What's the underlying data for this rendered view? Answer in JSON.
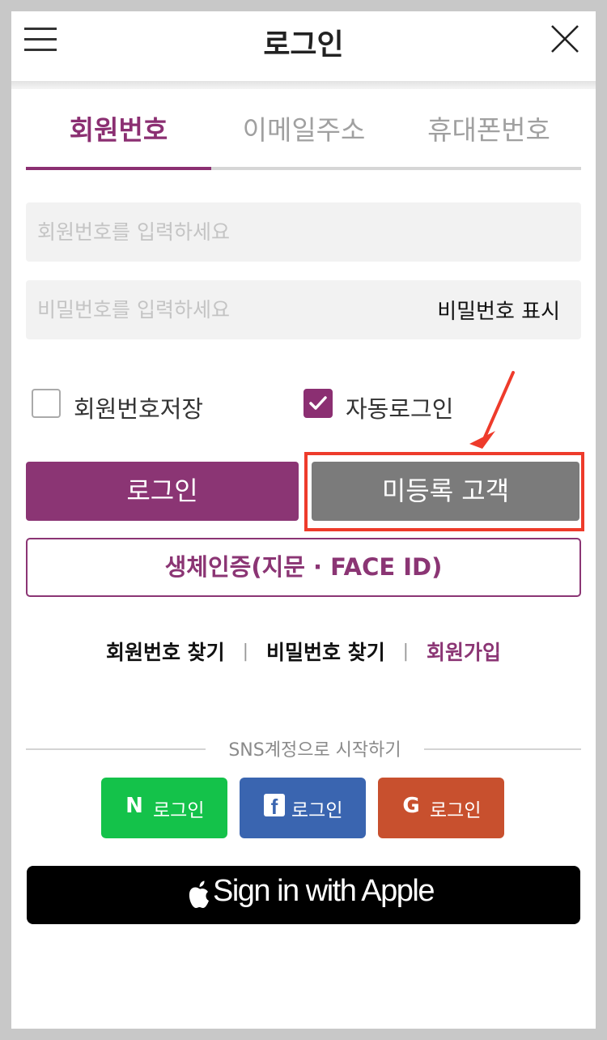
{
  "header": {
    "title": "로그인"
  },
  "tabs": [
    {
      "label": "회원번호",
      "active": true
    },
    {
      "label": "이메일주소",
      "active": false
    },
    {
      "label": "휴대폰번호",
      "active": false
    }
  ],
  "form": {
    "member_placeholder": "회원번호를 입력하세요",
    "password_placeholder": "비밀번호를 입력하세요",
    "show_password_label": "비밀번호 표시"
  },
  "options": {
    "save_member_label": "회원번호저장",
    "save_member_checked": false,
    "auto_login_label": "자동로그인",
    "auto_login_checked": true
  },
  "buttons": {
    "login_label": "로그인",
    "guest_label": "미등록 고객",
    "biometric_label": "생체인증(지문 · FACE ID)"
  },
  "links": {
    "find_member": "회원번호 찾기",
    "find_password": "비밀번호 찾기",
    "signup": "회원가입",
    "separator": "|"
  },
  "sns": {
    "title": "SNS계정으로 시작하기",
    "naver_label": "로그인",
    "facebook_label": "로그인",
    "google_label": "로그인",
    "naver_icon": "N",
    "facebook_icon": "f",
    "google_icon": "G"
  },
  "apple": {
    "label": "Sign in with Apple"
  },
  "colors": {
    "accent": "#8b3574",
    "guest_button": "#7b7b7b",
    "highlight": "#ee3b2b",
    "naver": "#14c24a",
    "facebook": "#3a65b0",
    "google": "#c8502e"
  }
}
